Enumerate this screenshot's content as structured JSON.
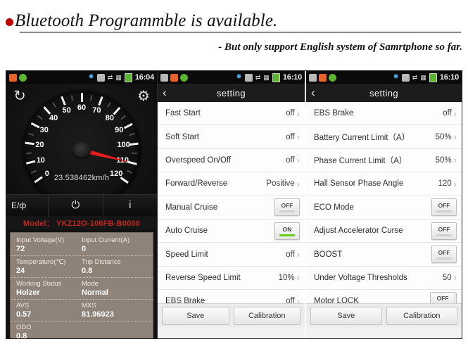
{
  "header": {
    "bullet_color": "#c00000",
    "headline": "Bluetooth Programmble is available.",
    "subline": "- But only support English system of Samrtphone so far."
  },
  "dashboard": {
    "statusbar": {
      "time": "16:04",
      "icons": [
        "gallery-icon",
        "orange-app-icon",
        "green-app-icon",
        "bluetooth-icon",
        "sdcard-icon",
        "usb-icon",
        "signal-icon",
        "battery-icon"
      ]
    },
    "refresh_label": "↻",
    "gear_label": "⚙",
    "gauge": {
      "min": 0,
      "max": 120,
      "step": 10,
      "ticks": [
        "0",
        "10",
        "20",
        "30",
        "40",
        "50",
        "60",
        "70",
        "80",
        "90",
        "100",
        "110",
        "120"
      ],
      "needle_value": 23.538462,
      "readout": "23.538462km/h",
      "unit": "km/h"
    },
    "controls": {
      "e_label": "E/ф",
      "power_label": "⏻",
      "info_label": "i"
    },
    "model_line": "Model： YKZ12O-106FB-B0000",
    "model_color": "#c0271d",
    "data_rows": [
      [
        {
          "key": "Input Voltage(V)",
          "value": "72"
        },
        {
          "key": "Input Current(A)",
          "value": "0"
        }
      ],
      [
        {
          "key": "Temperature(℃)",
          "value": "24"
        },
        {
          "key": "Trip Distance",
          "value": "0.8"
        }
      ],
      [
        {
          "key": "Working Status",
          "value": "Holzer"
        },
        {
          "key": "Mode",
          "value": "Normal"
        }
      ],
      [
        {
          "key": "AVS",
          "value": "0.57"
        },
        {
          "key": "MXS",
          "value": "81.96923"
        }
      ],
      [
        {
          "key": "ODO",
          "value": "0.8"
        }
      ]
    ]
  },
  "settings_1": {
    "statusbar": {
      "time": "16:10"
    },
    "back_label": "‹",
    "title": "setting",
    "rows": [
      {
        "label": "Fast Start",
        "type": "value",
        "value": "off"
      },
      {
        "label": "Soft Start",
        "type": "value",
        "value": "off"
      },
      {
        "label": "Overspeed On/Off",
        "type": "value",
        "value": "off"
      },
      {
        "label": "Forward/Reverse",
        "type": "value",
        "value": "Positive"
      },
      {
        "label": "Manual Cruise",
        "type": "toggle",
        "value": "OFF",
        "state": "off"
      },
      {
        "label": "Auto Cruise",
        "type": "toggle",
        "value": "ON",
        "state": "on"
      },
      {
        "label": "Speed Limit",
        "type": "value",
        "value": "off"
      },
      {
        "label": "Reverse Speed Limit",
        "type": "value",
        "value": "10%"
      },
      {
        "label": "EBS Brake",
        "type": "value",
        "value": "off"
      }
    ],
    "footer": {
      "save": "Save",
      "calibration": "Calibration"
    }
  },
  "settings_2": {
    "statusbar": {
      "time": "16:10"
    },
    "back_label": "‹",
    "title": "setting",
    "rows": [
      {
        "label": "EBS Brake",
        "type": "value",
        "value": "off"
      },
      {
        "label": "Battery Current Limit（A）",
        "type": "value",
        "value": "50%"
      },
      {
        "label": "Phase Current Limit（A）",
        "type": "value",
        "value": "50%"
      },
      {
        "label": "Hall Sensor Phase Angle",
        "type": "value",
        "value": "120"
      },
      {
        "label": "ECO Mode",
        "type": "toggle",
        "value": "OFF",
        "state": "off"
      },
      {
        "label": "Adjust Accelerator Curse",
        "type": "toggle",
        "value": "OFF",
        "state": "off"
      },
      {
        "label": "BOOST",
        "type": "toggle",
        "value": "OFF",
        "state": "off"
      },
      {
        "label": "Under Voltage Thresholds",
        "type": "value",
        "value": "50"
      },
      {
        "label": "Motor LOCK",
        "type": "toggle",
        "value": "OFF",
        "state": "off"
      }
    ],
    "partial_row_value": "OFF",
    "footer": {
      "save": "Save",
      "calibration": "Calibration"
    }
  }
}
